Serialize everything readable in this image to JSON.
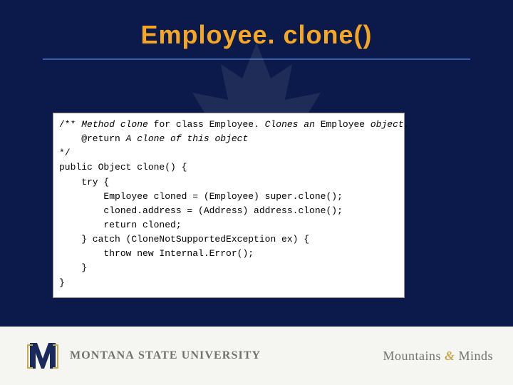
{
  "title": "Employee. clone()",
  "code": {
    "l1": "/** Method clone for class Employee. Clones an Employee object.",
    "l2": "    @return A clone of this object",
    "l3": "*/",
    "l4": "public Object clone() {",
    "l5": "    try {",
    "l6": "        Employee cloned = (Employee) super.clone();",
    "l7": "        cloned.address = (Address) address.clone();",
    "l8": "        return cloned;",
    "l9": "    } catch (CloneNotSupportedException ex) {",
    "l10": "        throw new Internal.Error();",
    "l11": "    }",
    "l12": "}"
  },
  "footer": {
    "univ_bold": "MONTANA",
    "univ_rest": " STATE UNIVERSITY",
    "tag_left": "Mountains ",
    "tag_amp": "&",
    "tag_right": " Minds"
  },
  "colors": {
    "accent": "#f5a623",
    "bg": "#0b1a4a"
  }
}
